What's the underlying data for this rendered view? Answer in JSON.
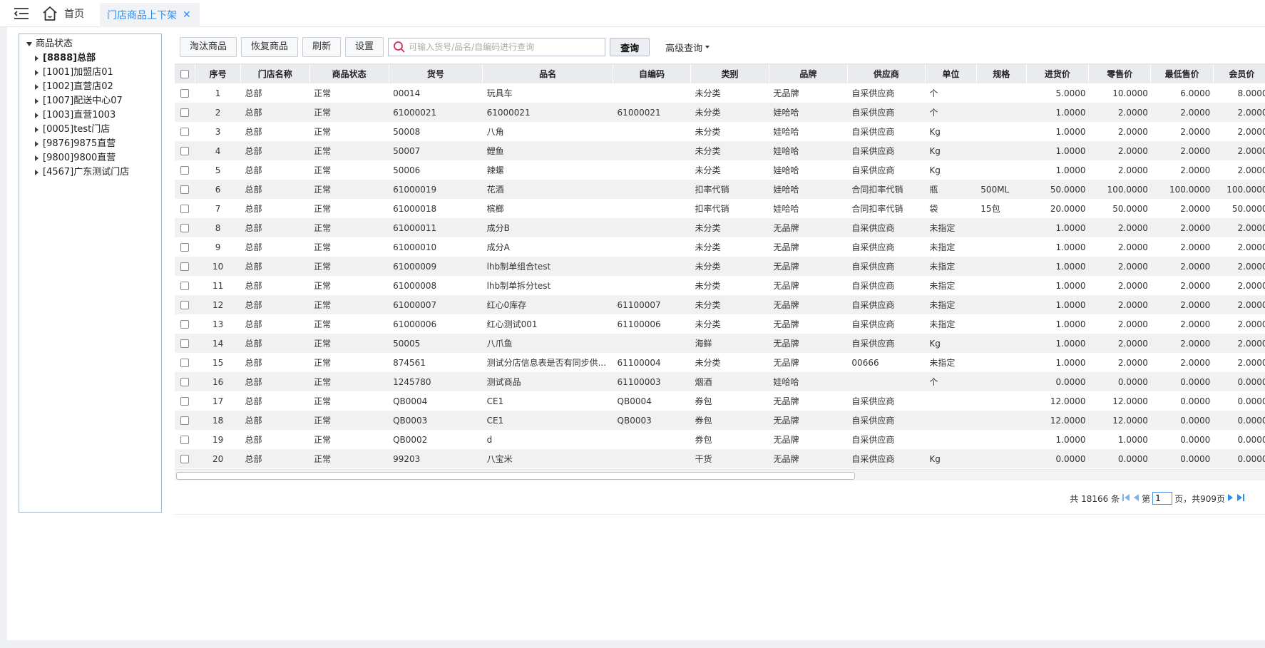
{
  "tabs": {
    "home_label": "首页",
    "active_label": "门店商品上下架",
    "close_glyph": "✕"
  },
  "tree": {
    "root_label": "商品状态",
    "children": [
      {
        "label": "[8888]总部",
        "bold": true
      },
      {
        "label": "[1001]加盟店01"
      },
      {
        "label": "[1002]直营店02"
      },
      {
        "label": "[1007]配送中心07"
      },
      {
        "label": "[1003]直营1003"
      },
      {
        "label": "[0005]test门店"
      },
      {
        "label": "[9876]9875直营"
      },
      {
        "label": "[9800]9800直营"
      },
      {
        "label": "[4567]广东测试门店"
      }
    ]
  },
  "toolbar": {
    "retire_label": "淘汰商品",
    "restore_label": "恢复商品",
    "refresh_label": "刷新",
    "settings_label": "设置",
    "search_placeholder": "可输入货号/品名/自编码进行查询",
    "query_label": "查询",
    "advanced_label": "高级查询"
  },
  "columns": [
    "序号",
    "门店名称",
    "商品状态",
    "货号",
    "品名",
    "自编码",
    "类别",
    "品牌",
    "供应商",
    "单位",
    "规格",
    "进货价",
    "零售价",
    "最低售价",
    "会员价"
  ],
  "rows": [
    [
      "1",
      "总部",
      "正常",
      "00014",
      "玩具车",
      "",
      "未分类",
      "无品牌",
      "自采供应商",
      "个",
      "",
      "5.0000",
      "10.0000",
      "6.0000",
      "8.0000"
    ],
    [
      "2",
      "总部",
      "正常",
      "61000021",
      "61000021",
      "61000021",
      "未分类",
      "娃哈哈",
      "自采供应商",
      "个",
      "",
      "1.0000",
      "2.0000",
      "2.0000",
      "2.0000"
    ],
    [
      "3",
      "总部",
      "正常",
      "50008",
      "八角",
      "",
      "未分类",
      "娃哈哈",
      "自采供应商",
      "Kg",
      "",
      "1.0000",
      "2.0000",
      "2.0000",
      "2.0000"
    ],
    [
      "4",
      "总部",
      "正常",
      "50007",
      "鲤鱼",
      "",
      "未分类",
      "娃哈哈",
      "自采供应商",
      "Kg",
      "",
      "1.0000",
      "2.0000",
      "2.0000",
      "2.0000"
    ],
    [
      "5",
      "总部",
      "正常",
      "50006",
      "辣螺",
      "",
      "未分类",
      "娃哈哈",
      "自采供应商",
      "Kg",
      "",
      "1.0000",
      "2.0000",
      "2.0000",
      "2.0000"
    ],
    [
      "6",
      "总部",
      "正常",
      "61000019",
      "花酒",
      "",
      "扣率代销",
      "娃哈哈",
      "合同扣率代销",
      "瓶",
      "500ML",
      "50.0000",
      "100.0000",
      "100.0000",
      "100.0000"
    ],
    [
      "7",
      "总部",
      "正常",
      "61000018",
      "槟榔",
      "",
      "扣率代销",
      "娃哈哈",
      "合同扣率代销",
      "袋",
      "15包",
      "20.0000",
      "50.0000",
      "2.0000",
      "50.0000"
    ],
    [
      "8",
      "总部",
      "正常",
      "61000011",
      "成分B",
      "",
      "未分类",
      "无品牌",
      "自采供应商",
      "未指定",
      "",
      "1.0000",
      "2.0000",
      "2.0000",
      "2.0000"
    ],
    [
      "9",
      "总部",
      "正常",
      "61000010",
      "成分A",
      "",
      "未分类",
      "无品牌",
      "自采供应商",
      "未指定",
      "",
      "1.0000",
      "2.0000",
      "2.0000",
      "2.0000"
    ],
    [
      "10",
      "总部",
      "正常",
      "61000009",
      "lhb制单组合test",
      "",
      "未分类",
      "无品牌",
      "自采供应商",
      "未指定",
      "",
      "1.0000",
      "2.0000",
      "2.0000",
      "2.0000"
    ],
    [
      "11",
      "总部",
      "正常",
      "61000008",
      "lhb制单拆分test",
      "",
      "未分类",
      "无品牌",
      "自采供应商",
      "未指定",
      "",
      "1.0000",
      "2.0000",
      "2.0000",
      "2.0000"
    ],
    [
      "12",
      "总部",
      "正常",
      "61000007",
      "红心0库存",
      "61100007",
      "未分类",
      "无品牌",
      "自采供应商",
      "未指定",
      "",
      "1.0000",
      "2.0000",
      "2.0000",
      "2.0000"
    ],
    [
      "13",
      "总部",
      "正常",
      "61000006",
      "红心测试001",
      "61100006",
      "未分类",
      "无品牌",
      "自采供应商",
      "未指定",
      "",
      "1.0000",
      "2.0000",
      "2.0000",
      "2.0000"
    ],
    [
      "14",
      "总部",
      "正常",
      "50005",
      "八爪鱼",
      "",
      "海鲜",
      "无品牌",
      "自采供应商",
      "Kg",
      "",
      "1.0000",
      "2.0000",
      "2.0000",
      "2.0000"
    ],
    [
      "15",
      "总部",
      "正常",
      "874561",
      "测试分店信息表是否有同步供...",
      "61100004",
      "未分类",
      "无品牌",
      "00666",
      "未指定",
      "",
      "1.0000",
      "2.0000",
      "2.0000",
      "2.0000"
    ],
    [
      "16",
      "总部",
      "正常",
      "1245780",
      "测试商品",
      "61100003",
      "烟酒",
      "娃哈哈",
      "",
      "个",
      "",
      "0.0000",
      "0.0000",
      "0.0000",
      "0.0000"
    ],
    [
      "17",
      "总部",
      "正常",
      "QB0004",
      "CE1",
      "QB0004",
      "券包",
      "无品牌",
      "自采供应商",
      "",
      "",
      "12.0000",
      "12.0000",
      "0.0000",
      "0.0000"
    ],
    [
      "18",
      "总部",
      "正常",
      "QB0003",
      "CE1",
      "QB0003",
      "券包",
      "无品牌",
      "自采供应商",
      "",
      "",
      "12.0000",
      "12.0000",
      "0.0000",
      "0.0000"
    ],
    [
      "19",
      "总部",
      "正常",
      "QB0002",
      "d",
      "",
      "券包",
      "无品牌",
      "自采供应商",
      "",
      "",
      "1.0000",
      "1.0000",
      "0.0000",
      "0.0000"
    ],
    [
      "20",
      "总部",
      "正常",
      "99203",
      "八宝米",
      "",
      "干货",
      "无品牌",
      "自采供应商",
      "Kg",
      "",
      "0.0000",
      "0.0000",
      "0.0000",
      "0.0000"
    ]
  ],
  "pager": {
    "total_text": "共 18166 条",
    "page_prefix": "第",
    "current_page": "1",
    "page_suffix": "页，共909页"
  },
  "colors": {
    "accent": "#2d8cf0",
    "search_icon": "#e0245e"
  },
  "icons": {
    "menu": "menu-fold-icon",
    "home": "home-icon",
    "search": "search-icon",
    "first": "first-page-icon",
    "prev": "prev-page-icon",
    "next": "next-page-icon",
    "last": "last-page-icon"
  }
}
